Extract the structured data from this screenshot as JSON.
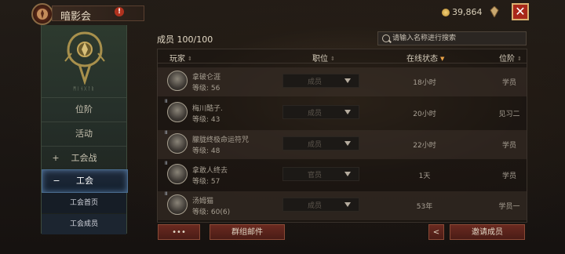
{
  "topbar": {
    "guild_name": "暗影会",
    "info_icon": "!",
    "gold": "39,864",
    "close_label": "✕"
  },
  "sidebar": {
    "emblem_caption": "ᛗᛁᚾᚷᛚᚱ",
    "items": [
      {
        "label": "位阶",
        "prefix": ""
      },
      {
        "label": "活动",
        "prefix": ""
      },
      {
        "label": "工会战",
        "prefix": "+"
      },
      {
        "label": "工会",
        "prefix": "−"
      }
    ],
    "sub_items": [
      {
        "label": "工会首页"
      },
      {
        "label": "工会成员"
      }
    ]
  },
  "members": {
    "header": "成员 100/100",
    "search_placeholder": "请输入名称进行搜索",
    "columns": {
      "player": "玩家",
      "rank": "职位",
      "online": "在线状态",
      "position": "位阶"
    },
    "rows": [
      {
        "name": "拿破仑涯",
        "level": "等级: 56",
        "rank": "成员",
        "online": "18小时",
        "position": "学员",
        "badge": ""
      },
      {
        "name": "梅川酷子.",
        "level": "等级: 43",
        "rank": "成员",
        "online": "20小时",
        "position": "见习二",
        "badge": "II"
      },
      {
        "name": "朦胧终极命运符咒",
        "level": "等级: 48",
        "rank": "成员",
        "online": "22小时",
        "position": "学员",
        "badge": "II"
      },
      {
        "name": "拿敢人终去",
        "level": "等级: 57",
        "rank": "官员",
        "online": "1天",
        "position": "学员",
        "badge": "II"
      },
      {
        "name": "汤姆猫",
        "level": "等级: 60(6)",
        "rank": "成员",
        "online": "53年",
        "position": "学员一",
        "badge": "II"
      }
    ]
  },
  "buttons": {
    "more": "•••",
    "group_mail": "群组邮件",
    "share": "<",
    "invite": "邀请成员"
  },
  "colors": {
    "accent_red": "#a8281a",
    "sidebar_green": "#2d3a2e",
    "active_blue": "#4a6c8e",
    "sort_active": "#e8a248"
  }
}
